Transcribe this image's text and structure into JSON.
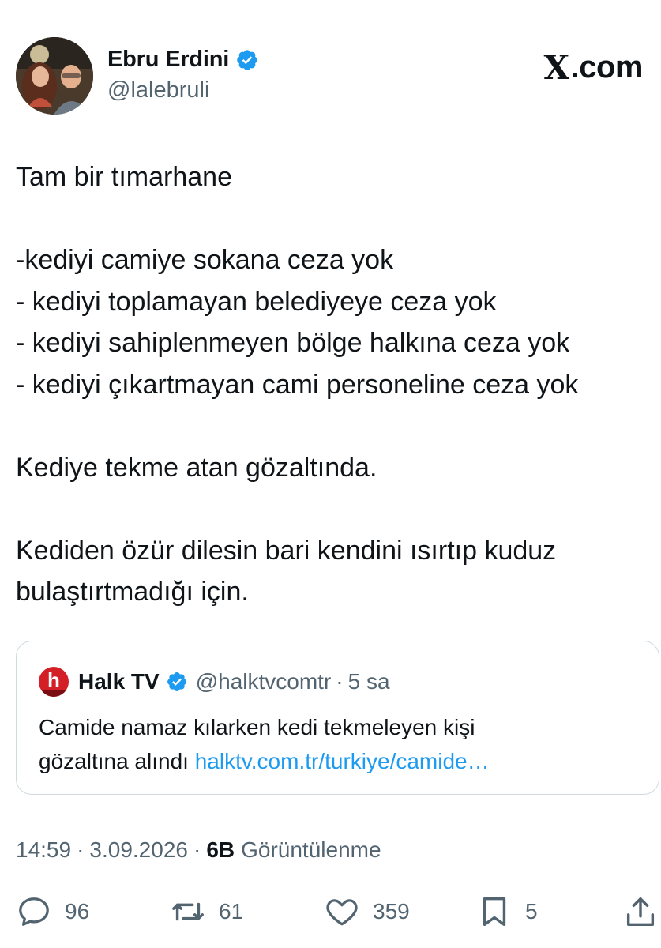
{
  "author": {
    "display_name": "Ebru Erdini",
    "handle": "@lalebruli"
  },
  "brand": {
    "logo_text": ".com",
    "logo_mark": "X"
  },
  "tweet": {
    "lines": [
      "Tam bir tımarhane",
      "",
      "-kediyi camiye sokana ceza yok",
      "- kediyi toplamayan belediyeye ceza yok",
      "- kediyi sahiplenmeyen bölge halkına ceza yok",
      "- kediyi çıkartmayan cami personeline ceza yok",
      "",
      "Kediye tekme atan gözaltında.",
      "",
      "Kediden özür dilesin bari kendini ısırtıp kuduz",
      "bulaştırtmadığı için."
    ]
  },
  "quote": {
    "avatar_letter": "h",
    "display_name": "Halk TV",
    "handle": "@halktvcomtr",
    "separator": "·",
    "time": "5 sa",
    "text_line1": "Camide namaz kılarken kedi tekmeleyen kişi",
    "text_line2_prefix": "gözaltına alındı ",
    "link": "halktv.com.tr/turkiye/camide…"
  },
  "meta": {
    "time": "14:59",
    "date": "3.09.2026",
    "separator": "·",
    "views_count": "6B",
    "views_label": "Görüntülenme"
  },
  "actions": {
    "replies": "96",
    "reposts": "61",
    "likes": "359",
    "bookmarks": "5"
  },
  "colors": {
    "text": "#0f1419",
    "secondary": "#536471",
    "verified": "#1d9bf0",
    "link": "#1d9bf0",
    "border": "#cfd9de",
    "halk_red": "#d31f26"
  },
  "icons": [
    "verified-badge-icon",
    "x-logo-icon",
    "reply-icon",
    "repost-icon",
    "like-icon",
    "bookmark-icon",
    "share-icon"
  ]
}
